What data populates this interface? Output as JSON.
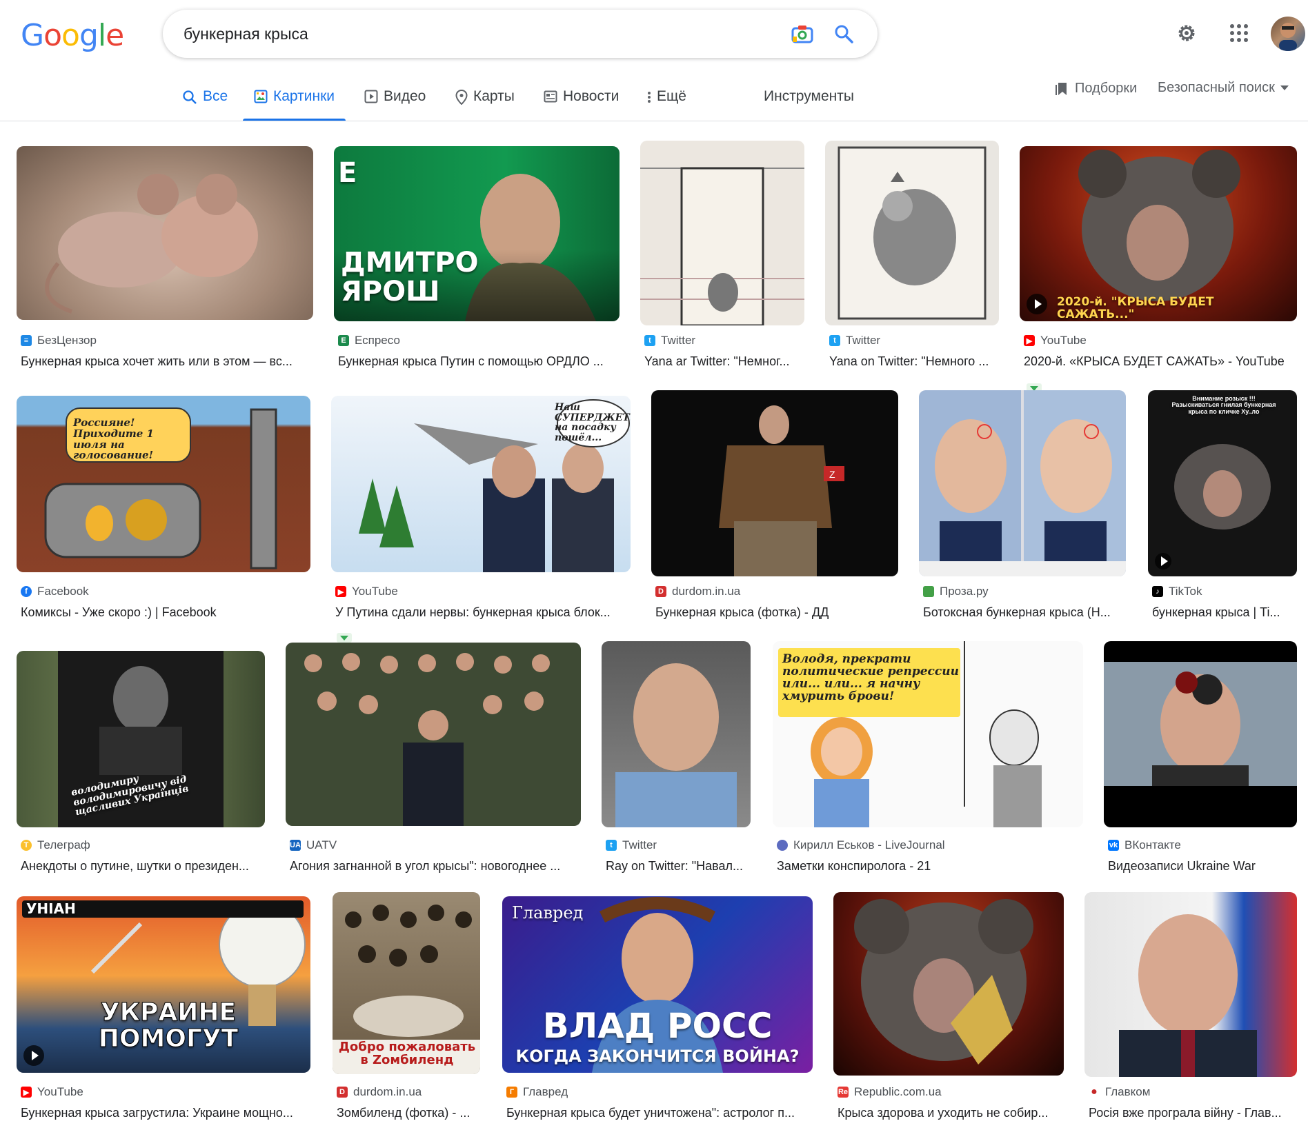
{
  "logo": {
    "letters": [
      "G",
      "o",
      "o",
      "g",
      "l",
      "e"
    ],
    "colors": [
      "#4285F4",
      "#EA4335",
      "#FBBC05",
      "#4285F4",
      "#34A853",
      "#EA4335"
    ]
  },
  "search": {
    "query": "бункерная крыса"
  },
  "icons": {
    "camera": "camera-icon",
    "search": "search-icon",
    "settings": "gear-icon",
    "apps": "apps-grid-icon"
  },
  "tabs": [
    {
      "label": "Все",
      "icon": "search-icon",
      "active": false
    },
    {
      "label": "Картинки",
      "icon": "image-icon",
      "active": true
    },
    {
      "label": "Видео",
      "icon": "play-icon",
      "active": false
    },
    {
      "label": "Карты",
      "icon": "map-pin-icon",
      "active": false
    },
    {
      "label": "Новости",
      "icon": "newspaper-icon",
      "active": false
    },
    {
      "label": "Ещё",
      "icon": "more-vert-icon",
      "active": false
    }
  ],
  "tools_label": "Инструменты",
  "collections_label": "Подборки",
  "safesearch_label": "Безопасный поиск",
  "results": [
    {
      "source": "БезЦензор",
      "title": "Бункерная крыса хочет жить или в этом — вс...",
      "favicon": "#1e88e5"
    },
    {
      "source": "Еспресо",
      "title": "Бункерная крыса Путин с помощью ОРДЛО ...",
      "favicon": "#1b8a4c"
    },
    {
      "source": "Twitter",
      "title": "Yana ar Twitter: \"Немног...",
      "favicon": "#1da1f2"
    },
    {
      "source": "Twitter",
      "title": "Yana on Twitter: \"Немного ...",
      "favicon": "#1da1f2"
    },
    {
      "source": "YouTube",
      "title": "2020-й. «КРЫСА БУДЕТ САЖАТЬ» - YouTube",
      "favicon": "#ff0000",
      "overlay": "2020-й. \"КРЫСА БУДЕТ САЖАТЬ...\""
    },
    {
      "source": "Facebook",
      "title": "Комиксы - Уже скоро :) | Facebook",
      "favicon": "#1877f2",
      "overlay": "Россияне! Приходите 1 июля на голосование!"
    },
    {
      "source": "YouTube",
      "title": "У Путина сдали нервы: бункерная крыса блок...",
      "favicon": "#ff0000",
      "overlay": "Наш СУПЕРДЖЕТ! на посадку пошёл..."
    },
    {
      "source": "durdom.in.ua",
      "title": "Бункерная крыса (фотка) - ДД",
      "favicon": "#d32f2f"
    },
    {
      "source": "Проза.ру",
      "title": "Ботоксная бункерная крыса (Н...",
      "favicon": "#43a047"
    },
    {
      "source": "TikTok",
      "title": "бункерная крыса | Ti...",
      "favicon": "#000000",
      "overlay": "Внимание розыск !!! Разыскиваться гнилая бункерная крыса по кличке Ху..ло"
    },
    {
      "source": "Телеграф",
      "title": "Анекдоты о путине, шутки о президен...",
      "favicon": "#fbc02d",
      "overlay": "володимиру володимировичу від щасливих Українців"
    },
    {
      "source": "UATV",
      "title": "Агония загнанной в угол крысы\": новогоднее ...",
      "favicon": "#1565c0"
    },
    {
      "source": "Twitter",
      "title": "Ray on Twitter: \"Навал...",
      "favicon": "#1da1f2"
    },
    {
      "source": "Кирилл Еськов - LiveJournal",
      "title": "Заметки конспиролога - 21",
      "favicon": "#5c6bc0",
      "overlay": "Володя, прекрати политические репрессии или... или... я начну хмурить брови!"
    },
    {
      "source": "ВКонтакте",
      "title": "Видеозаписи Ukraine War",
      "favicon": "#0077ff"
    },
    {
      "source": "YouTube",
      "title": "Бункерная крыса загрустила: Украине мощно...",
      "favicon": "#ff0000",
      "overlay": "УКРАИНЕ ПОМОГУТ",
      "badge": "УНІАН"
    },
    {
      "source": "durdom.in.ua",
      "title": "Зомбиленд (фотка) - ...",
      "favicon": "#d32f2f",
      "overlay": "Добро пожаловать в Zомбиленд"
    },
    {
      "source": "Главред",
      "title": "Бункерная крыса будет уничтожена\": астролог п...",
      "favicon": "#f57c00",
      "overlay": "ВЛАД РОСС",
      "overlay2": "КОГДА ЗАКОНЧИТСЯ ВОЙНА?",
      "badge": "Главред"
    },
    {
      "source": "Republic.com.ua",
      "title": "Крыса здорова и уходить не собир...",
      "favicon": "#e53935"
    },
    {
      "source": "Главком",
      "title": "Росія вже програла війну - Глав...",
      "favicon": "#c62828"
    }
  ],
  "extra_overlays": {
    "espreso_name": "ДМИТРО ЯРОШ"
  }
}
